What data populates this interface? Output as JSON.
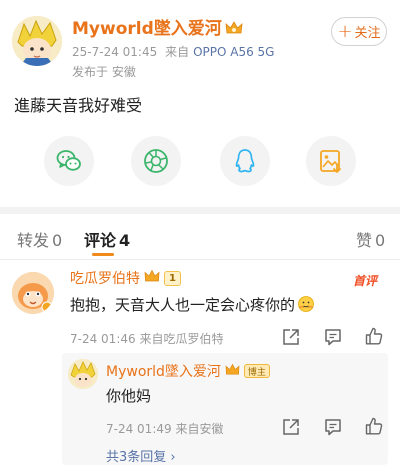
{
  "post": {
    "username": "Myworld墜入爱河",
    "timestamp": "25-7-24 01:45",
    "source_prefix": "来自",
    "device": "OPPO A56 5G",
    "location": "发布于 安徽",
    "follow_plus": "+",
    "follow_label": "关注",
    "content": "進藤天音我好难受"
  },
  "share": {
    "buttons": [
      "wechat-icon",
      "moments-icon",
      "qq-icon",
      "qzone-icon"
    ],
    "colors": {
      "wechat": "#3bb56b",
      "moments": "#3bb56b",
      "qq": "#2fb4f0",
      "qzone": "#f5a623"
    }
  },
  "tabs": {
    "repost_label": "转发",
    "repost_count": "0",
    "comment_label": "评论",
    "comment_count": "4",
    "like_label": "赞",
    "like_count": "0"
  },
  "comment": {
    "username": "吃瓜罗伯特",
    "level_badge": "1",
    "top_tag": "首评",
    "text": "抱抱，天音大人也一定会心疼你的",
    "meta": "7-24 01:46 来自吃瓜罗伯特"
  },
  "reply": {
    "username": "Myworld墜入爱河",
    "author_badge": "博主",
    "text": "你他妈",
    "meta": "7-24 01:49 来自安徽",
    "more_link": "共3条回复 ›"
  },
  "colors": {
    "accent": "#e8731a",
    "link": "#5a74a8",
    "tab_underline": "#f08a1b",
    "top_tag": "#f04d23"
  }
}
